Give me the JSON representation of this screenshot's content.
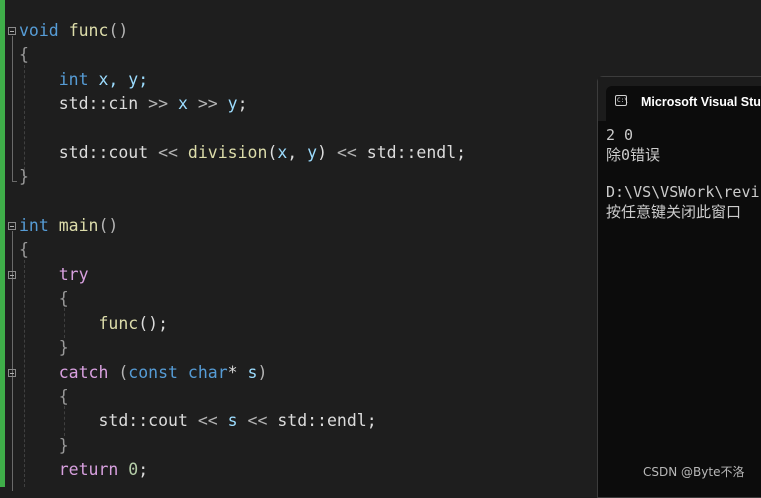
{
  "editor": {
    "code": {
      "l1": {
        "kw": "void",
        "sp": " ",
        "fn": "func",
        "p": "()"
      },
      "l2": {
        "brace": "{"
      },
      "l3": {
        "indent": "    ",
        "kw": "int",
        "rest": " x, y;"
      },
      "l4": {
        "indent": "    ",
        "a": "std::cin ",
        "op1": ">>",
        "sp1": " ",
        "v1": "x",
        "sp2": " ",
        "op2": ">>",
        "sp3": " ",
        "v2": "y",
        "end": ";"
      },
      "l6": {
        "indent": "    ",
        "a": "std::cout ",
        "op1": "<<",
        "sp1": " ",
        "fn": "division",
        "p1": "(",
        "v1": "x",
        "c": ", ",
        "v2": "y",
        "p2": ") ",
        "op2": "<<",
        "b": " std::endl;"
      },
      "l7": {
        "brace": "}"
      },
      "l9": {
        "kw": "int",
        "sp": " ",
        "fn": "main",
        "p": "()"
      },
      "l10": {
        "brace": "{"
      },
      "l11": {
        "indent": "    ",
        "kw2": "try"
      },
      "l12": {
        "indent": "    ",
        "brace": "{"
      },
      "l13": {
        "indent": "        ",
        "fn": "func",
        "p": "();"
      },
      "l14": {
        "indent": "    ",
        "brace": "}"
      },
      "l15": {
        "indent": "    ",
        "kw2": "catch",
        "sp": " ",
        "p1": "(",
        "kwa": "const",
        "sp2": " ",
        "kwb": "char",
        "star": "* ",
        "v": "s",
        "p2": ")"
      },
      "l16": {
        "indent": "    ",
        "brace": "{"
      },
      "l17": {
        "indent": "        ",
        "a": "std::cout ",
        "op1": "<<",
        "sp1": " ",
        "v": "s",
        "sp2": " ",
        "op2": "<<",
        "b": " std::endl;"
      },
      "l18": {
        "indent": "    ",
        "brace": "}"
      },
      "l19": {
        "indent": "    ",
        "kw2": "return",
        "sp": " ",
        "num": "0",
        "end": ";"
      }
    }
  },
  "console": {
    "title": "Microsoft Visual Studio",
    "icon": "console-window-icon",
    "lines": [
      "2 0",
      "除0错误",
      "",
      "D:\\VS\\VSWork\\revis",
      "按任意键关闭此窗口"
    ]
  },
  "watermark": "CSDN @Byte不洛",
  "colors": {
    "keyword": "#569cd6",
    "control": "#d8a0df",
    "function": "#dcdcaa",
    "variable": "#9cdcfe",
    "number": "#b5cea8",
    "change_bar": "#3fae49"
  }
}
